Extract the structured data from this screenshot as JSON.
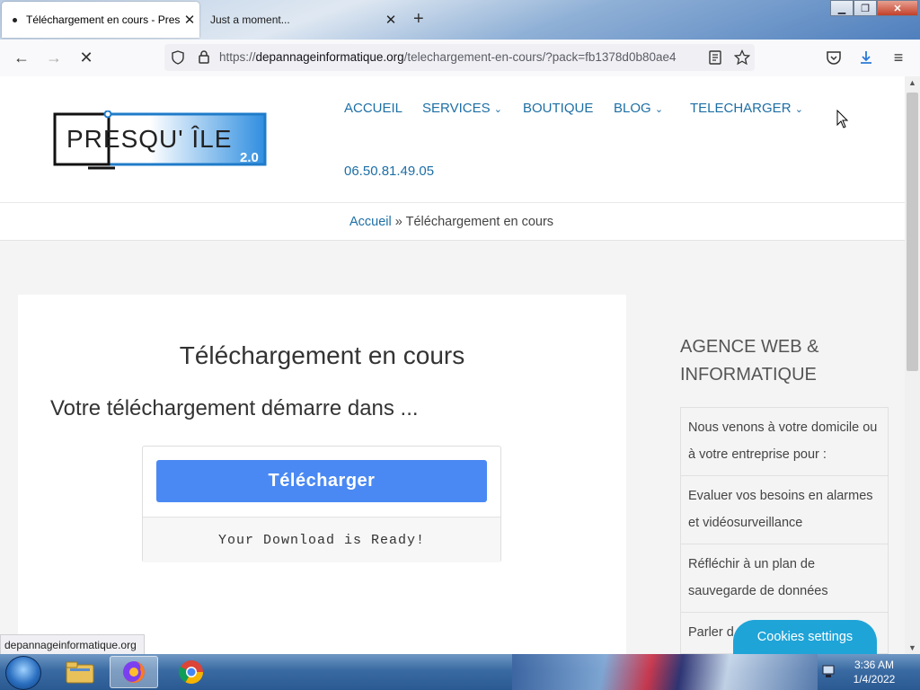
{
  "browser": {
    "tabs": [
      {
        "title": "Téléchargement en cours - Presqu'île",
        "active": true
      },
      {
        "title": "Just a moment...",
        "active": false
      }
    ],
    "url_prefix": "https://",
    "url_host": "depannageinformatique.org",
    "url_path": "/telechargement-en-cours/?pack=fb1378d0b80ae4",
    "status_text": "depannageinformatique.org"
  },
  "site": {
    "logo_text": "PRESQU' ÎLE",
    "logo_version": "2.0",
    "menu": [
      {
        "label": "ACCUEIL",
        "dropdown": false
      },
      {
        "label": "SERVICES",
        "dropdown": true
      },
      {
        "label": "BOUTIQUE",
        "dropdown": false
      },
      {
        "label": "BLOG",
        "dropdown": true
      },
      {
        "label": "TELECHARGER",
        "dropdown": true
      }
    ],
    "phone": "06.50.81.49.05",
    "breadcrumb": {
      "home": "Accueil",
      "separator": "»",
      "current": "Téléchargement en cours"
    }
  },
  "main": {
    "title": "Téléchargement en cours",
    "subtitle": "Votre téléchargement démarre dans ...",
    "download_button": "Télécharger",
    "download_status": "Your Download is Ready!"
  },
  "sidebar": {
    "title": "AGENCE WEB & INFORMATIQUE",
    "items": [
      "Nous venons à votre domicile ou à votre entreprise pour :",
      "Evaluer vos besoins en alarmes et vidéosurveillance",
      "Réfléchir à un plan de sauvegarde de données",
      "Parler d"
    ]
  },
  "cookies_button": "Cookies settings",
  "taskbar": {
    "time": "3:36 AM",
    "date": "1/4/2022"
  },
  "colors": {
    "link": "#1d6fa5",
    "button": "#4a89f3",
    "cookies": "#1fa4d8"
  }
}
